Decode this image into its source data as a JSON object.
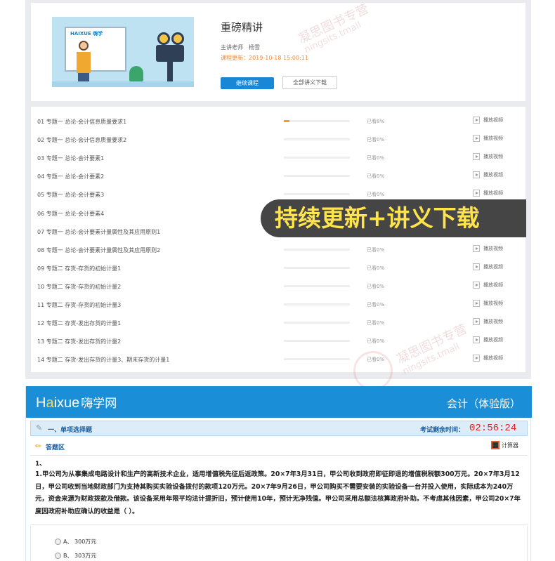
{
  "course": {
    "title": "重磅精讲",
    "teacher_label": "主讲老师",
    "teacher_name": "杨雪",
    "updated": "课程更新：2019-10-18 15:00:11",
    "continue_button": "继续课程",
    "download_button": "全部讲义下载",
    "thumb_logo": "HAIXUE 嗨学"
  },
  "lessons": [
    {
      "name": "01 专题一 总论-会计信息质量要求1",
      "progress": 0.08,
      "status": "已看8%",
      "play": "播放视频"
    },
    {
      "name": "02 专题一 总论-会计信息质量要求2",
      "progress": 0,
      "status": "已看0%",
      "play": "播放视频"
    },
    {
      "name": "03 专题一 总论-会计要素1",
      "progress": 0,
      "status": "已看0%",
      "play": "播放视频"
    },
    {
      "name": "04 专题一 总论-会计要素2",
      "progress": 0,
      "status": "已看0%",
      "play": "播放视频"
    },
    {
      "name": "05 专题一 总论-会计要素3",
      "progress": 0,
      "status": "已看0%",
      "play": "播放视频"
    },
    {
      "name": "06 专题一 总论-会计要素4",
      "progress": 0,
      "status": "",
      "play": ""
    },
    {
      "name": "07 专题一 总论-会计要素计量属性及其应用原则1",
      "progress": 0,
      "status": "",
      "play": ""
    },
    {
      "name": "08 专题一 总论-会计要素计量属性及其应用原则2",
      "progress": 0,
      "status": "已看0%",
      "play": "播放视频"
    },
    {
      "name": "09 专题二 存货-存货的初始计量1",
      "progress": 0,
      "status": "已看0%",
      "play": "播放视频"
    },
    {
      "name": "10 专题二 存货-存货的初始计量2",
      "progress": 0,
      "status": "已看0%",
      "play": "播放视频"
    },
    {
      "name": "11 专题二 存货-存货的初始计量3",
      "progress": 0,
      "status": "已看0%",
      "play": "播放视频"
    },
    {
      "name": "12 专题二 存货-发出存货的计量1",
      "progress": 0,
      "status": "已看0%",
      "play": "播放视频"
    },
    {
      "name": "13 专题二 存货-发出存货的计量2",
      "progress": 0,
      "status": "已看0%",
      "play": "播放视频"
    },
    {
      "name": "14 专题二 存货-发出存货的计量3、期末存货的计量1",
      "progress": 0,
      "status": "已看0%",
      "play": "播放视频"
    }
  ],
  "banner": "持续更新+讲义下载",
  "watermark": "凝思图书专营",
  "watermark_url": "ningsits.tmall",
  "exam": {
    "logo_h": "H",
    "logo_a": "a",
    "logo_rest": "ixue",
    "logo_cn": "嗨学网",
    "subject": "会计（体验版）",
    "section_title": "一、单项选择题",
    "time_label": "考试剩余时间：",
    "time_value": "02:56:24",
    "answer_area": "答题区",
    "calculator": "计算器",
    "question_no": "1、",
    "question_text": "1.甲公司为从事集成电路设计和生产的高新技术企业，适用增值税先征后返政策。20×7年3月31日，甲公司收到政府即征即退的增值税税额300万元。20×7年3月12日，甲公司收到当地财政部门为支持其购买实验设备拨付的款项120万元。20×7年9月26日，甲公司购买不需要安装的实验设备一台并投入使用，实际成本为240万元，资金来源为财政拨款及借款。该设备采用年限平均法计提折旧，预计使用10年，预计无净残值。甲公司采用总额法核算政府补助。不考虑其他因素，甲公司20×7年度因政府补助应确认的收益是（ ）。",
    "options": [
      "A、 300万元",
      "B、 303万元"
    ]
  }
}
